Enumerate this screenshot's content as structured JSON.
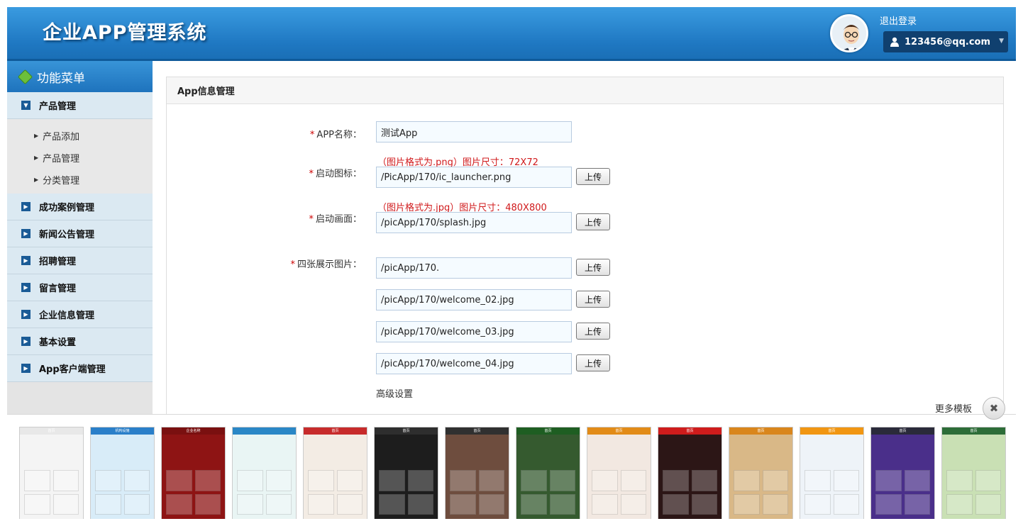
{
  "header": {
    "title": "企业APP管理系统",
    "logout": "退出登录",
    "user": "123456@qq.com"
  },
  "sidebar": {
    "title": "功能菜单",
    "groups": [
      {
        "label": "产品管理",
        "sub": [
          "产品添加",
          "产品管理",
          "分类管理"
        ]
      },
      {
        "label": "成功案例管理"
      },
      {
        "label": "新闻公告管理"
      },
      {
        "label": "招聘管理"
      },
      {
        "label": "留言管理"
      },
      {
        "label": "企业信息管理"
      },
      {
        "label": "基本设置"
      },
      {
        "label": "App客户端管理"
      }
    ]
  },
  "panel": {
    "title": "App信息管理",
    "app_name_label": "APP名称：",
    "app_name_value": "测试App",
    "icon_label": "启动图标：",
    "icon_hint": "（图片格式为.png）图片尺寸：72X72",
    "icon_value": "/PicApp/170/ic_launcher.png",
    "splash_label": "启动画面：",
    "splash_hint": "（图片格式为.jpg）图片尺寸：480X800",
    "splash_value": "/picApp/170/splash.jpg",
    "four_label": "四张展示图片：",
    "four_values": [
      "/picApp/170.",
      "/picApp/170/welcome_02.jpg",
      "/picApp/170/welcome_03.jpg",
      "/picApp/170/welcome_04.jpg"
    ],
    "upload_label": "上传",
    "required_mark": "*",
    "advanced": "高级设置"
  },
  "templates": {
    "more": "更多模板",
    "close": "✖",
    "items": [
      {
        "title": "首页",
        "bar": "#e8e8e8",
        "bg": "#f4f4f4"
      },
      {
        "title": "机构设施",
        "bar": "#2a7fc9",
        "bg": "#d8ecf8"
      },
      {
        "title": "企业名称",
        "bar": "#7a1010",
        "bg": "#8e1414"
      },
      {
        "title": "",
        "bar": "#2a87c6",
        "bg": "#e9f5f4"
      },
      {
        "title": "首页",
        "bar": "#c72b2b",
        "bg": "#f3ece4"
      },
      {
        "title": "首页",
        "bar": "#2e2e2e",
        "bg": "#1d1d1d"
      },
      {
        "title": "首页",
        "bar": "#303030",
        "bg": "#6e4d3e"
      },
      {
        "title": "首页",
        "bar": "#1e5e22",
        "bg": "#355a2f"
      },
      {
        "title": "首页",
        "bar": "#e28b17",
        "bg": "#f2e8e1"
      },
      {
        "title": "首页",
        "bar": "#cf1c1c",
        "bg": "#2c1616"
      },
      {
        "title": "首页",
        "bar": "#d9861c",
        "bg": "#d9b887"
      },
      {
        "title": "首页",
        "bar": "#f19612",
        "bg": "#eef3f8"
      },
      {
        "title": "首页",
        "bar": "#2a2a3a",
        "bg": "#4a2f8a"
      },
      {
        "title": "首页",
        "bar": "#2d6d38",
        "bg": "#c9e0b4"
      }
    ]
  }
}
